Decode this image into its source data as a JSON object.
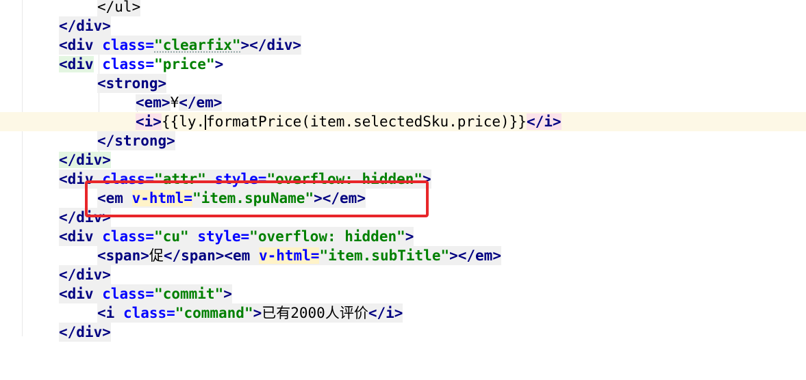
{
  "editor": {
    "lines": [
      "</ul>",
      "</div>",
      "<div class=\"clearfix\"></div>",
      "<div class=\"price\">",
      "<strong>",
      "<em>¥</em>",
      "<i>{{ly.formatPrice(item.selectedSku.price)}}</i>",
      "</strong>",
      "</div>",
      "<div class=\"attr\" style=\"overflow: hidden\">",
      "<em v-html=\"item.spuName\"></em>",
      "</div>",
      "<div class=\"cu\" style=\"overflow: hidden\">",
      "<span>促</span><em v-html=\"item.subTitle\"></em>",
      "</div>",
      "<div class=\"commit\">",
      "<i class=\"command\">已有2000人评价</i>",
      "</div>"
    ]
  },
  "annotation": {
    "color": "#e8262a",
    "target": "<em v-html=\"item.spuName\"></em>"
  },
  "colors": {
    "tag": "#000080",
    "attribute": "#0000ff",
    "string": "#008000",
    "current_line": "#fdf8e6"
  }
}
